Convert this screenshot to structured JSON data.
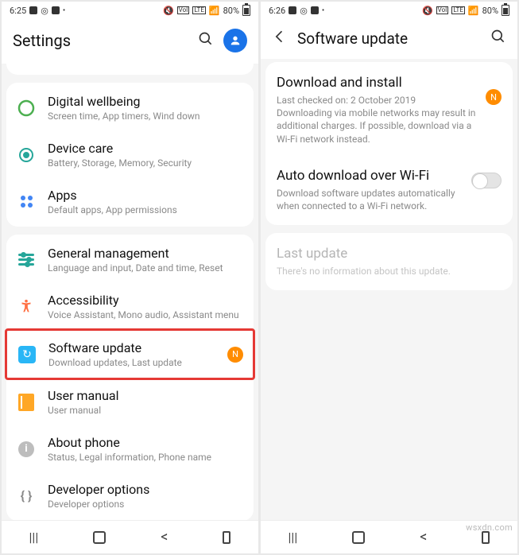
{
  "left": {
    "status": {
      "time": "6:25",
      "battery": "80%",
      "net1": "VoI",
      "net2": "LTE"
    },
    "header": {
      "title": "Settings"
    },
    "items": [
      {
        "title": "Digital wellbeing",
        "sub": "Screen time, App timers, Wind down"
      },
      {
        "title": "Device care",
        "sub": "Battery, Storage, Memory, Security"
      },
      {
        "title": "Apps",
        "sub": "Default apps, App permissions"
      },
      {
        "title": "General management",
        "sub": "Language and input, Date and time, Reset"
      },
      {
        "title": "Accessibility",
        "sub": "Voice Assistant, Mono audio, Assistant menu"
      },
      {
        "title": "Software update",
        "sub": "Download updates, Last update",
        "badge": "N"
      },
      {
        "title": "User manual",
        "sub": "User manual"
      },
      {
        "title": "About phone",
        "sub": "Status, Legal information, Phone name"
      },
      {
        "title": "Developer options",
        "sub": "Developer options"
      }
    ]
  },
  "right": {
    "status": {
      "time": "6:26",
      "battery": "80%",
      "net1": "VoI",
      "net2": "LTE"
    },
    "header": {
      "title": "Software update"
    },
    "download": {
      "title": "Download and install",
      "checked": "Last checked on: 2 October 2019",
      "note": "Downloading via mobile networks may result in additional charges. If possible, download via a Wi-Fi network instead.",
      "badge": "N"
    },
    "auto": {
      "title": "Auto download over Wi-Fi",
      "note": "Download software updates automatically when connected to a Wi-Fi network."
    },
    "last": {
      "title": "Last update",
      "note": "There's no information about this update."
    }
  },
  "watermark": "wsxdn.com"
}
